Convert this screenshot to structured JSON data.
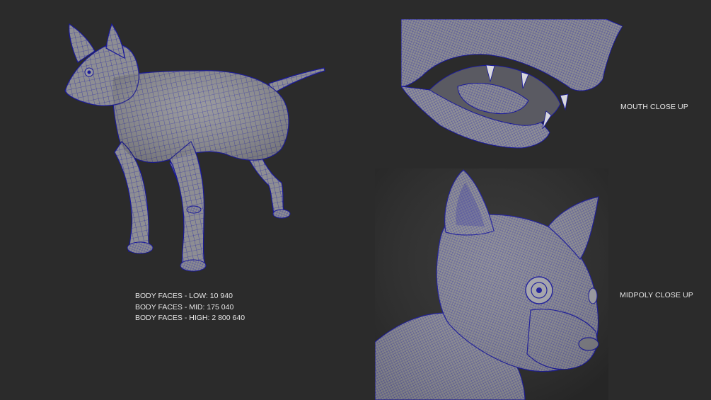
{
  "labels": {
    "mouth": "MOUTH CLOSE UP",
    "midpoly": "MIDPOLY CLOSE UP"
  },
  "stats": [
    "BODY FACES - LOW: 10 940",
    "BODY FACES - MID: 175 040",
    "BODY FACES - HIGH: 2 800 640"
  ],
  "colors": {
    "background": "#2b2b2b",
    "mesh_fill": "#8d8d92",
    "wireframe": "#1f1fa8",
    "text": "#e6e6e6"
  }
}
